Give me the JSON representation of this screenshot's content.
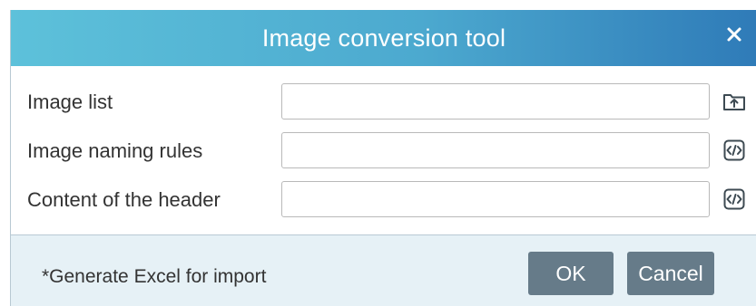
{
  "dialog": {
    "title": "Image conversion tool",
    "close_icon": "close-icon",
    "accent_color": "#4ca9cf"
  },
  "form": {
    "fields": [
      {
        "label": "Image list",
        "value": "",
        "icon": "upload-folder-icon"
      },
      {
        "label": "Image naming rules",
        "value": "",
        "icon": "code-icon"
      },
      {
        "label": "Content of the header",
        "value": "",
        "icon": "code-icon"
      }
    ]
  },
  "footer": {
    "hint": "*Generate Excel for import",
    "ok_label": "OK",
    "cancel_label": "Cancel",
    "button_color": "#667b89"
  }
}
